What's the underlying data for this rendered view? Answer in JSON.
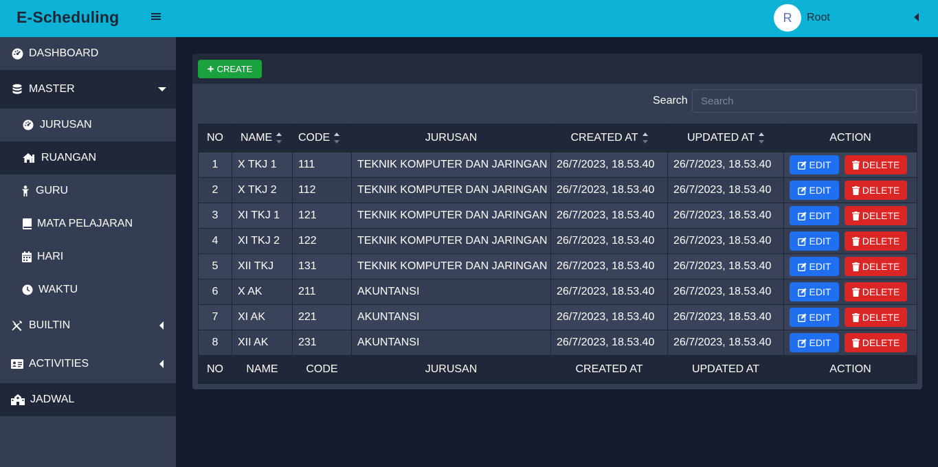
{
  "brand": "E-Scheduling",
  "user": {
    "initial": "R",
    "name": "Root"
  },
  "colors": {
    "header": "#0db3d6",
    "create": "#1aa23e",
    "edit": "#1f6ff0",
    "delete": "#dc2525"
  },
  "sidebar": {
    "items": [
      {
        "label": "DASHBOARD",
        "icon": "gauge-icon"
      },
      {
        "label": "MASTER",
        "icon": "database-icon"
      },
      {
        "label": "JURUSAN",
        "icon": "gauge-icon"
      },
      {
        "label": "RUANGAN",
        "icon": "house-icon"
      },
      {
        "label": "GURU",
        "icon": "person-icon"
      },
      {
        "label": "MATA PELAJARAN",
        "icon": "book-icon"
      },
      {
        "label": "HARI",
        "icon": "calendar-icon"
      },
      {
        "label": "WAKTU",
        "icon": "clock-icon"
      },
      {
        "label": "BUILTIN",
        "icon": "tools-icon"
      },
      {
        "label": "ACTIVITIES",
        "icon": "id-card-icon"
      },
      {
        "label": "JADWAL",
        "icon": "school-icon"
      }
    ]
  },
  "toolbar": {
    "create_label": "CREATE"
  },
  "search": {
    "label": "Search",
    "placeholder": "Search",
    "value": ""
  },
  "table": {
    "headers": [
      "NO",
      "NAME",
      "CODE",
      "JURUSAN",
      "CREATED AT",
      "UPDATED AT",
      "ACTION"
    ],
    "footer": [
      "NO",
      "NAME",
      "CODE",
      "JURUSAN",
      "CREATED AT",
      "UPDATED AT",
      "ACTION"
    ],
    "edit_label": "EDIT",
    "delete_label": "DELETE",
    "rows": [
      [
        "1",
        "X TKJ 1",
        "111",
        "TEKNIK KOMPUTER DAN JARINGAN",
        "26/7/2023, 18.53.40",
        "26/7/2023, 18.53.40"
      ],
      [
        "2",
        "X TKJ 2",
        "112",
        "TEKNIK KOMPUTER DAN JARINGAN",
        "26/7/2023, 18.53.40",
        "26/7/2023, 18.53.40"
      ],
      [
        "3",
        "XI TKJ 1",
        "121",
        "TEKNIK KOMPUTER DAN JARINGAN",
        "26/7/2023, 18.53.40",
        "26/7/2023, 18.53.40"
      ],
      [
        "4",
        "XI TKJ 2",
        "122",
        "TEKNIK KOMPUTER DAN JARINGAN",
        "26/7/2023, 18.53.40",
        "26/7/2023, 18.53.40"
      ],
      [
        "5",
        "XII TKJ",
        "131",
        "TEKNIK KOMPUTER DAN JARINGAN",
        "26/7/2023, 18.53.40",
        "26/7/2023, 18.53.40"
      ],
      [
        "6",
        "X AK",
        "211",
        "AKUNTANSI",
        "26/7/2023, 18.53.40",
        "26/7/2023, 18.53.40"
      ],
      [
        "7",
        "XI AK",
        "221",
        "AKUNTANSI",
        "26/7/2023, 18.53.40",
        "26/7/2023, 18.53.40"
      ],
      [
        "8",
        "XII AK",
        "231",
        "AKUNTANSI",
        "26/7/2023, 18.53.40",
        "26/7/2023, 18.53.40"
      ]
    ]
  }
}
